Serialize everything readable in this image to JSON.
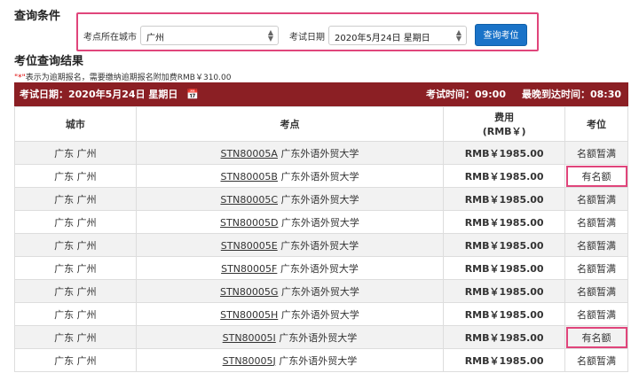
{
  "query_title": "查询条件",
  "form": {
    "city_label": "考点所在城市",
    "city_value": "广州",
    "date_label": "考试日期",
    "date_value": "2020年5月24日 星期日",
    "search_button": "查询考位"
  },
  "results_title": "考位查询结果",
  "note": {
    "star": "\"*\"",
    "text": "表示为逾期报名，需要缴纳逾期报名附加费RMB￥310.00"
  },
  "bar": {
    "exam_date": "考试日期：2020年5月24日 星期日",
    "exam_time": "考试时间：09:00",
    "latest_arrival": "最晚到达时间：08:30"
  },
  "columns": [
    "城市",
    "考点",
    "费用",
    "(RMB￥)",
    "考位"
  ],
  "rows": [
    {
      "city": "广东 广州",
      "code": "STN80005A",
      "name": " 广东外语外贸大学",
      "fee": "RMB￥1985.00",
      "seat": "名额暂满"
    },
    {
      "city": "广东 广州",
      "code": "STN80005B",
      "name": " 广东外语外贸大学",
      "fee": "RMB￥1985.00",
      "seat": "有名额"
    },
    {
      "city": "广东 广州",
      "code": "STN80005C",
      "name": " 广东外语外贸大学",
      "fee": "RMB￥1985.00",
      "seat": "名额暂满"
    },
    {
      "city": "广东 广州",
      "code": "STN80005D",
      "name": " 广东外语外贸大学",
      "fee": "RMB￥1985.00",
      "seat": "名额暂满"
    },
    {
      "city": "广东 广州",
      "code": "STN80005E",
      "name": " 广东外语外贸大学",
      "fee": "RMB￥1985.00",
      "seat": "名额暂满"
    },
    {
      "city": "广东 广州",
      "code": "STN80005F",
      "name": " 广东外语外贸大学",
      "fee": "RMB￥1985.00",
      "seat": "名额暂满"
    },
    {
      "city": "广东 广州",
      "code": "STN80005G",
      "name": " 广东外语外贸大学",
      "fee": "RMB￥1985.00",
      "seat": "名额暂满"
    },
    {
      "city": "广东 广州",
      "code": "STN80005H",
      "name": " 广东外语外贸大学",
      "fee": "RMB￥1985.00",
      "seat": "名额暂满"
    },
    {
      "city": "广东 广州",
      "code": "STN80005I",
      "name": " 广东外语外贸大学",
      "fee": "RMB￥1985.00",
      "seat": "有名额"
    },
    {
      "city": "广东 广州",
      "code": "STN80005J",
      "name": " 广东外语外贸大学",
      "fee": "RMB￥1985.00",
      "seat": "名额暂满"
    }
  ]
}
